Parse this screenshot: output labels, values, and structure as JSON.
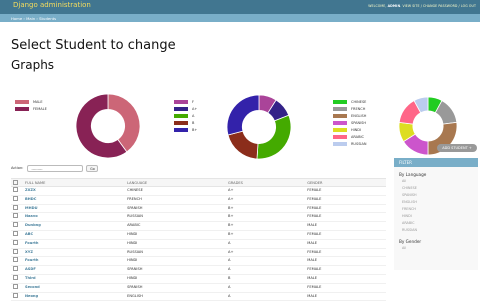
{
  "header": {
    "brand": "Django administration",
    "user_tools_welcome": "WELCOME, ",
    "user_tools_user": "ADMIN",
    "user_tools_links": ". VIEW SITE / CHANGE PASSWORD / LOG OUT",
    "bg_color": "#417690",
    "brand_color": "#f5dd5d"
  },
  "breadcrumbs": "Home › Main › Students",
  "page_title": "Select Student to change",
  "graphs_title": "Graphs",
  "charts": [
    {
      "type": "pie",
      "legend": [
        "MALE",
        "FEMALE"
      ],
      "values": [
        40,
        60
      ],
      "colors": [
        "#cc6677",
        "#882255"
      ]
    },
    {
      "type": "pie",
      "legend": [
        "F",
        "A+",
        "A",
        "B",
        "B+"
      ],
      "values": [
        9,
        10,
        32,
        20,
        29
      ],
      "colors": [
        "#aa4499",
        "#332288",
        "#44aa00",
        "#8b2d1b",
        "#3322aa"
      ]
    },
    {
      "type": "pie",
      "legend": [
        "CHINESE",
        "FRENCH",
        "ENGLISH",
        "SPANISH",
        "HINDI",
        "ARABIC",
        "RUSSIAN"
      ],
      "values": [
        8,
        15,
        27,
        16,
        11,
        15,
        8
      ],
      "colors": [
        "#22cc22",
        "#999999",
        "#a87850",
        "#cc55cc",
        "#dddd22",
        "#ff6688",
        "#bbccee"
      ]
    }
  ],
  "actions": {
    "label": "Action:",
    "select_value": "---------",
    "go_label": "Go"
  },
  "table": {
    "headers": [
      "FULL NAME",
      "LANGUAGE",
      "GRADES",
      "GENDER"
    ],
    "rows": [
      [
        "ZXZX",
        "CHINESE",
        "A+",
        "FEMALE"
      ],
      [
        "BHDC",
        "FRENCH",
        "A+",
        "FEMALE"
      ],
      [
        "MHDU",
        "SPANISH",
        "B+",
        "FEMALE"
      ],
      [
        "Naavo",
        "RUSSIAN",
        "B+",
        "FEMALE"
      ],
      [
        "Dunbng",
        "ARABIC",
        "B+",
        "MALE"
      ],
      [
        "ABC",
        "HINDI",
        "B+",
        "FEMALE"
      ],
      [
        "Fourth",
        "HINDI",
        "A",
        "MALE"
      ],
      [
        "XYZ",
        "RUSSIAN",
        "A+",
        "FEMALE"
      ],
      [
        "Fourth",
        "HINDI",
        "A",
        "MALE"
      ],
      [
        "ASDF",
        "SPANISH",
        "A",
        "FEMALE"
      ],
      [
        "Third",
        "HINDI",
        "B",
        "MALE"
      ],
      [
        "Second",
        "SPANISH",
        "A",
        "FEMALE"
      ],
      [
        "Neong",
        "ENGLISH",
        "A",
        "MALE"
      ]
    ]
  },
  "add_button": "ADD STUDENT +",
  "filter": {
    "header": "FILTER",
    "by_language": "By Language",
    "language_options": [
      "All",
      "CHINESE",
      "SPANISH",
      "ENGLISH",
      "FRENCH",
      "HINDI",
      "ARABIC",
      "RUSSIAN"
    ],
    "by_gender": "By Gender",
    "gender_options": [
      "All"
    ]
  }
}
